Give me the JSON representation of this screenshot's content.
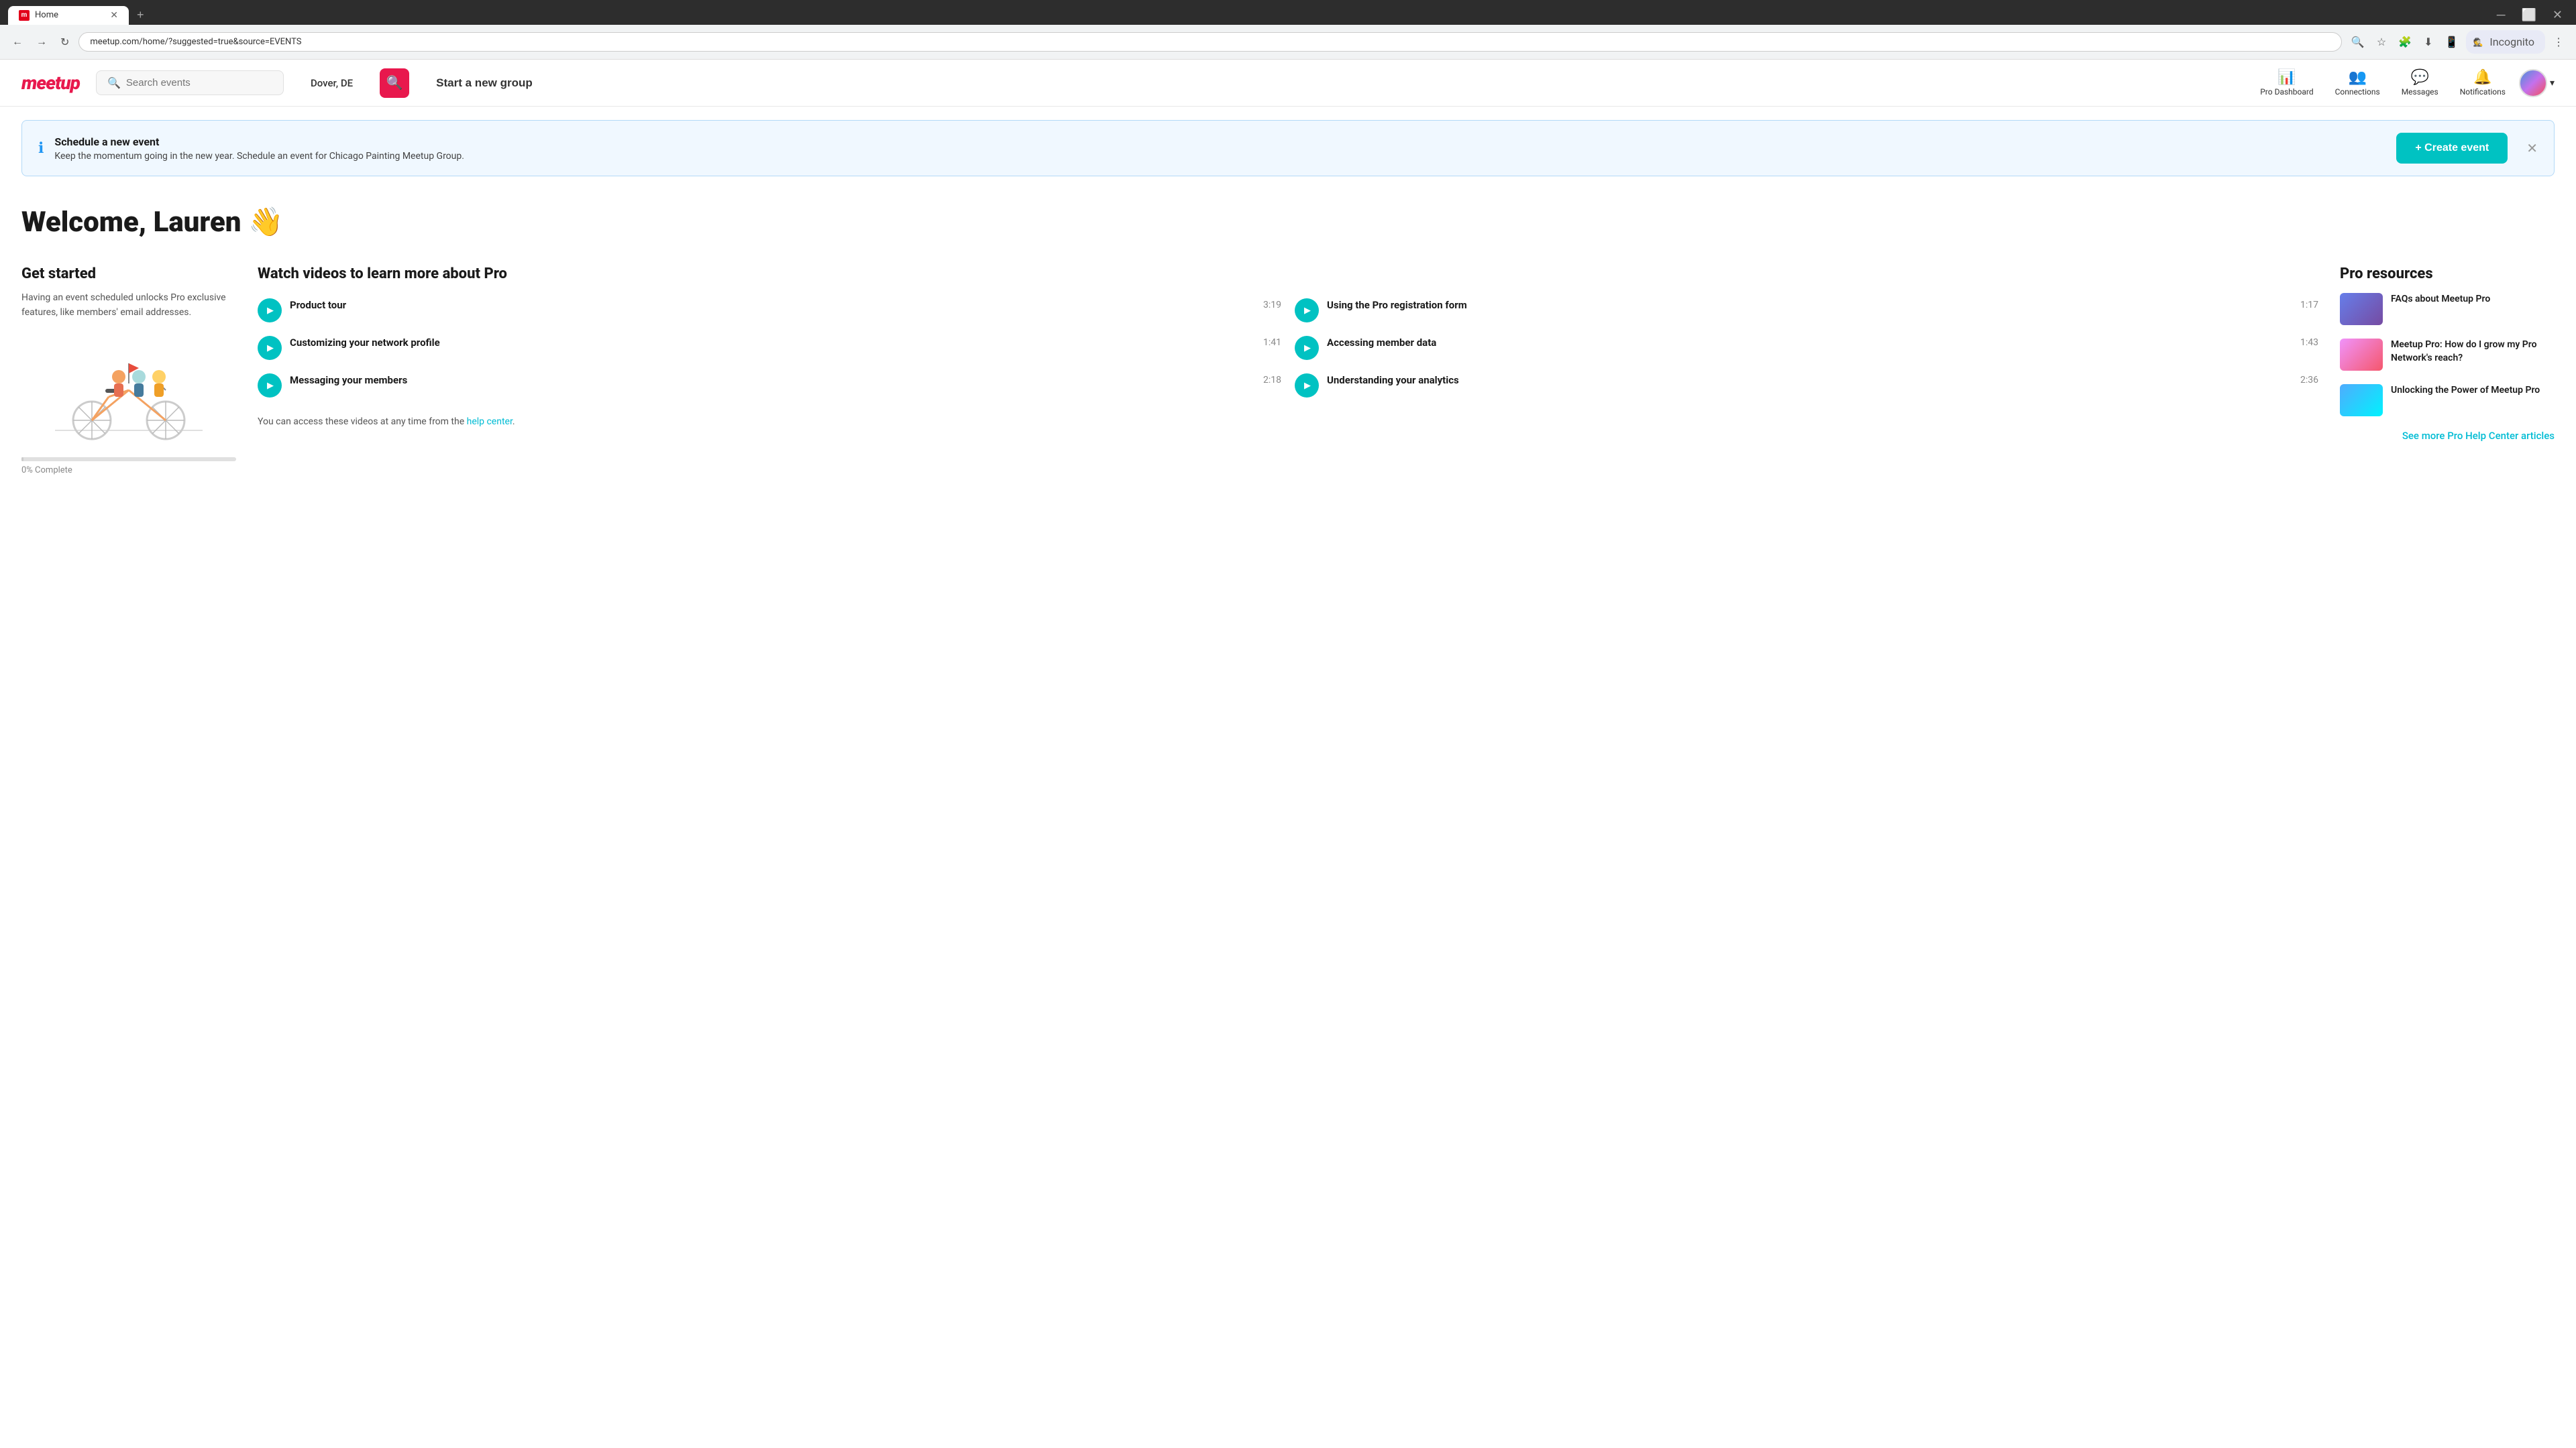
{
  "browser": {
    "tab_title": "Home",
    "tab_favicon": "M",
    "url": "meetup.com/home/?suggested=true&source=EVENTS",
    "incognito_label": "Incognito"
  },
  "header": {
    "logo": "meetup",
    "search_placeholder": "Search events",
    "location": "Dover, DE",
    "search_btn_icon": "🔍",
    "start_group_label": "Start a new group",
    "nav": {
      "pro_dashboard": "Pro Dashboard",
      "connections": "Connections",
      "messages": "Messages",
      "notifications": "Notifications"
    }
  },
  "banner": {
    "title": "Schedule a new event",
    "text": "Keep the momentum going in the new year. Schedule an event for Chicago Painting Meetup Group.",
    "create_btn": "+ Create event"
  },
  "welcome": {
    "text": "Welcome, Lauren 👋"
  },
  "get_started": {
    "title": "Get started",
    "description": "Having an event scheduled unlocks Pro exclusive features, like members' email addresses.",
    "progress_label": "0% Complete"
  },
  "videos": {
    "title": "Watch videos to learn more about Pro",
    "items": [
      {
        "title": "Product tour",
        "duration": "3:19"
      },
      {
        "title": "Using the Pro registration form",
        "duration": "1:17"
      },
      {
        "title": "Customizing your network profile",
        "duration": "1:41"
      },
      {
        "title": "Accessing member data",
        "duration": "1:43"
      },
      {
        "title": "Messaging your members",
        "duration": "2:18"
      },
      {
        "title": "Understanding your analytics",
        "duration": "2:36"
      }
    ],
    "note_prefix": "You can access these videos at any time from the ",
    "help_link": "help center",
    "note_suffix": "."
  },
  "pro_resources": {
    "title": "Pro resources",
    "items": [
      {
        "text": "FAQs about Meetup Pro",
        "thumb_class": "thumb-1"
      },
      {
        "text": "Meetup Pro: How do I grow my Pro Network's reach?",
        "thumb_class": "thumb-2"
      },
      {
        "text": "Unlocking the Power of Meetup Pro",
        "thumb_class": "thumb-3"
      }
    ],
    "see_more_label": "See more Pro Help Center articles"
  }
}
